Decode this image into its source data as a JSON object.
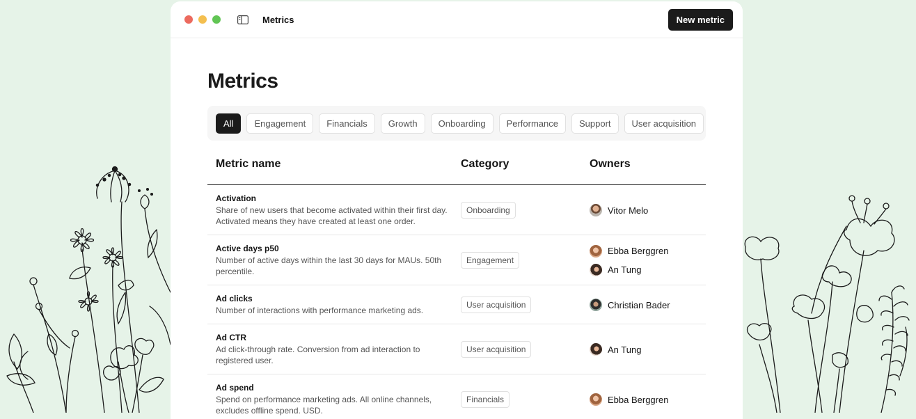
{
  "window": {
    "title": "Metrics",
    "new_button": "New metric"
  },
  "page": {
    "title": "Metrics"
  },
  "filters": [
    "All",
    "Engagement",
    "Financials",
    "Growth",
    "Onboarding",
    "Performance",
    "Support",
    "User acquisition"
  ],
  "active_filter": "All",
  "table": {
    "headers": {
      "name": "Metric name",
      "category": "Category",
      "owners": "Owners"
    },
    "rows": [
      {
        "name": "Activation",
        "description": "Share of new users that become activated within their first day. Activated means they have created at least one order.",
        "category": "Onboarding",
        "owners": [
          "Vitor Melo"
        ]
      },
      {
        "name": "Active days p50",
        "description": "Number of active days within the last 30 days for MAUs. 50th percentile.",
        "category": "Engagement",
        "owners": [
          "Ebba Berggren",
          "An Tung"
        ]
      },
      {
        "name": "Ad clicks",
        "description": "Number of interactions with performance marketing ads.",
        "category": "User acquisition",
        "owners": [
          "Christian Bader"
        ]
      },
      {
        "name": "Ad CTR",
        "description": "Ad click-through rate. Conversion from ad interaction to registered user.",
        "category": "User acquisition",
        "owners": [
          "An Tung"
        ]
      },
      {
        "name": "Ad spend",
        "description": "Spend on performance marketing ads. All online channels, excludes offline spend. USD.",
        "category": "Financials",
        "owners": [
          "Ebba Berggren"
        ]
      }
    ]
  },
  "colors": {
    "background": "#e6f3e8",
    "accent": "#1b1b1b"
  }
}
